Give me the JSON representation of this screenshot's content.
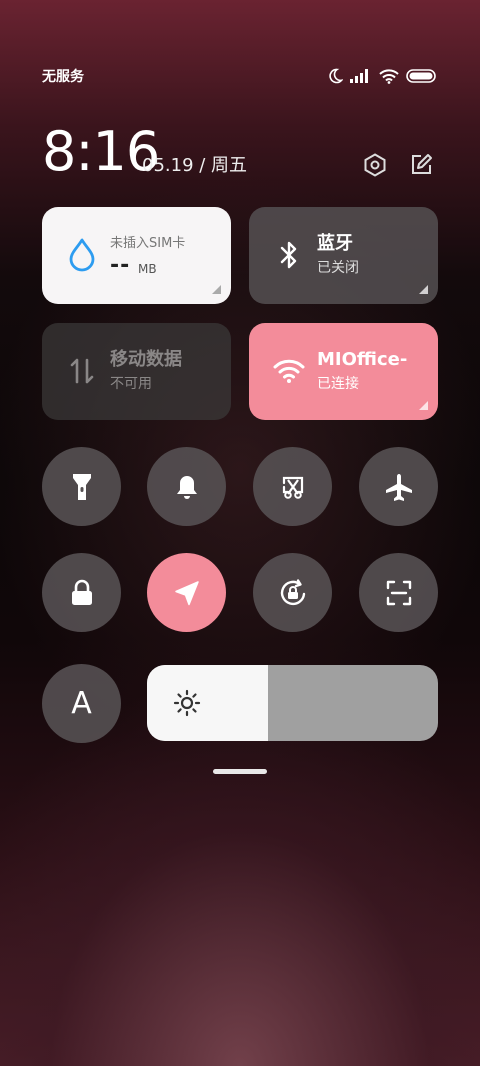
{
  "status_bar": {
    "carrier": "无服务",
    "icons": [
      "moon-icon",
      "signal-icon",
      "wifi-icon",
      "battery-icon"
    ]
  },
  "header": {
    "time": "8:16",
    "date": "05.19 / 周五",
    "buttons": [
      "settings-icon",
      "edit-icon"
    ]
  },
  "tiles": {
    "sim": {
      "title": "未插入SIM卡",
      "value": "--",
      "unit": "MB",
      "icon": "water-drop-icon",
      "accent": "#2d9cf0"
    },
    "bluetooth": {
      "title": "蓝牙",
      "subtitle": "已关闭",
      "icon": "bluetooth-icon"
    },
    "mobile_data": {
      "title": "移动数据",
      "subtitle": "不可用",
      "icon": "data-arrows-icon"
    },
    "wifi": {
      "title": "MIOffice-",
      "subtitle": "已连接",
      "icon": "wifi-icon",
      "accent": "#f38c9a"
    }
  },
  "toggles_row1": [
    {
      "name": "flashlight",
      "icon": "flashlight-icon",
      "active": false
    },
    {
      "name": "ring",
      "icon": "bell-icon",
      "active": false
    },
    {
      "name": "screenshot",
      "icon": "screenshot-icon",
      "active": false
    },
    {
      "name": "airplane",
      "icon": "airplane-icon",
      "active": false
    }
  ],
  "toggles_row2": [
    {
      "name": "lock",
      "icon": "lock-icon",
      "active": false
    },
    {
      "name": "location",
      "icon": "location-arrow-icon",
      "active": true
    },
    {
      "name": "rotation-lock",
      "icon": "rotation-lock-icon",
      "active": false
    },
    {
      "name": "scanner",
      "icon": "scan-icon",
      "active": false
    }
  ],
  "auto_brightness": {
    "label": "A"
  },
  "brightness": {
    "level": 0.417,
    "icon": "sun-icon"
  }
}
